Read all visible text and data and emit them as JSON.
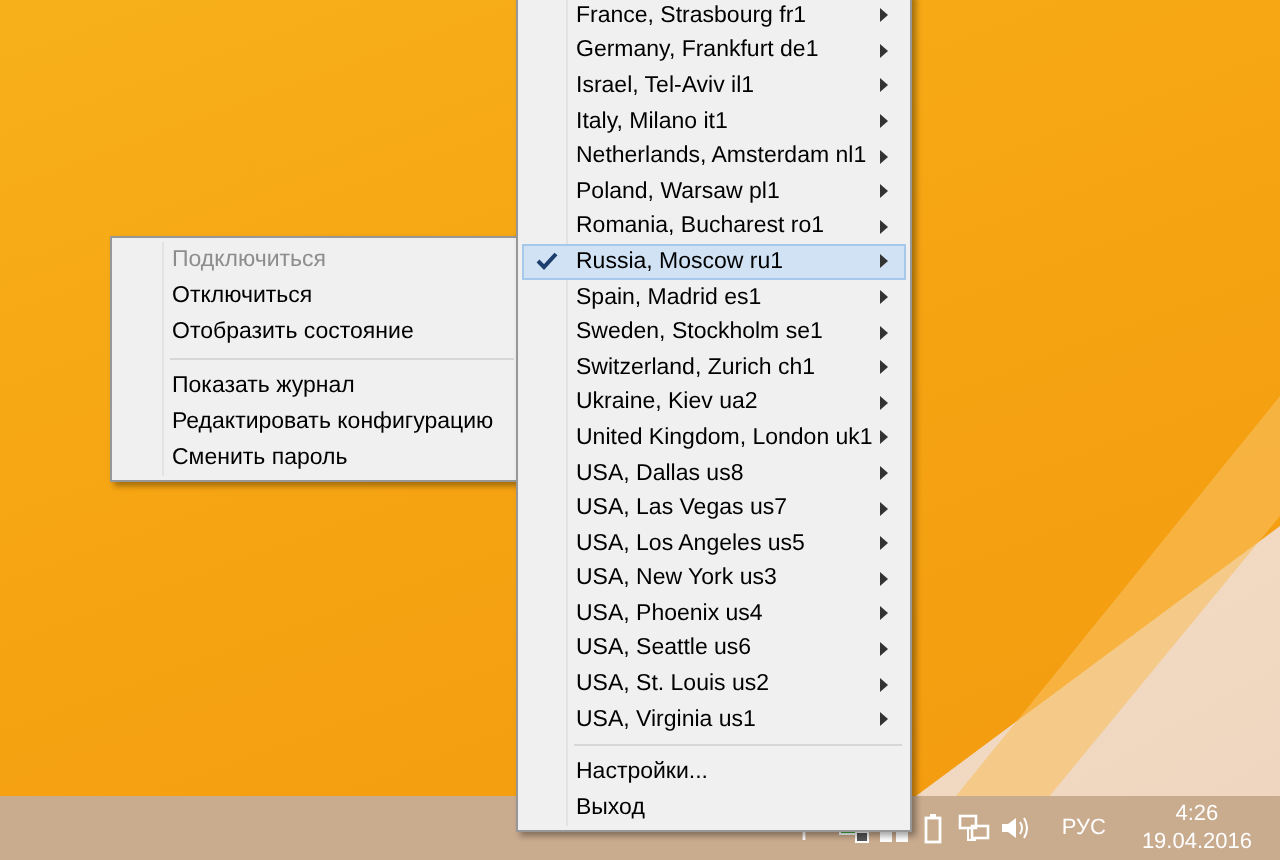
{
  "context_menu": {
    "items": [
      {
        "kind": "item",
        "label": "Подключиться",
        "disabled": true
      },
      {
        "kind": "item",
        "label": "Отключиться",
        "disabled": false
      },
      {
        "kind": "item",
        "label": "Отобразить состояние",
        "disabled": false
      },
      {
        "kind": "separator"
      },
      {
        "kind": "item",
        "label": "Показать журнал",
        "disabled": false
      },
      {
        "kind": "item",
        "label": "Редактировать конфигурацию",
        "disabled": false
      },
      {
        "kind": "item",
        "label": "Сменить пароль",
        "disabled": false
      }
    ]
  },
  "server_menu": {
    "items": [
      {
        "kind": "server",
        "label": "France, Strasbourg fr1",
        "checked": false
      },
      {
        "kind": "server",
        "label": "Germany, Frankfurt de1",
        "checked": false
      },
      {
        "kind": "server",
        "label": "Israel, Tel-Aviv il1",
        "checked": false
      },
      {
        "kind": "server",
        "label": "Italy, Milano it1",
        "checked": false
      },
      {
        "kind": "server",
        "label": "Netherlands, Amsterdam nl1",
        "checked": false
      },
      {
        "kind": "server",
        "label": "Poland, Warsaw pl1",
        "checked": false
      },
      {
        "kind": "server",
        "label": "Romania, Bucharest ro1",
        "checked": false
      },
      {
        "kind": "server",
        "label": "Russia, Moscow ru1",
        "checked": true
      },
      {
        "kind": "server",
        "label": "Spain, Madrid es1",
        "checked": false
      },
      {
        "kind": "server",
        "label": "Sweden, Stockholm se1",
        "checked": false
      },
      {
        "kind": "server",
        "label": "Switzerland, Zurich ch1",
        "checked": false
      },
      {
        "kind": "server",
        "label": "Ukraine, Kiev ua2",
        "checked": false
      },
      {
        "kind": "server",
        "label": "United Kingdom, London uk1",
        "checked": false
      },
      {
        "kind": "server",
        "label": "USA, Dallas us8",
        "checked": false
      },
      {
        "kind": "server",
        "label": "USA, Las Vegas us7",
        "checked": false
      },
      {
        "kind": "server",
        "label": "USA, Los Angeles us5",
        "checked": false
      },
      {
        "kind": "server",
        "label": "USA, New York us3",
        "checked": false
      },
      {
        "kind": "server",
        "label": "USA, Phoenix us4",
        "checked": false
      },
      {
        "kind": "server",
        "label": "USA, Seattle us6",
        "checked": false
      },
      {
        "kind": "server",
        "label": "USA, St. Louis us2",
        "checked": false
      },
      {
        "kind": "server",
        "label": "USA, Virginia us1",
        "checked": false
      },
      {
        "kind": "separator"
      },
      {
        "kind": "item",
        "label": "Настройки..."
      },
      {
        "kind": "item",
        "label": "Выход"
      }
    ]
  },
  "taskbar": {
    "language": "РУС",
    "time": "4:26",
    "date": "19.04.2016"
  }
}
